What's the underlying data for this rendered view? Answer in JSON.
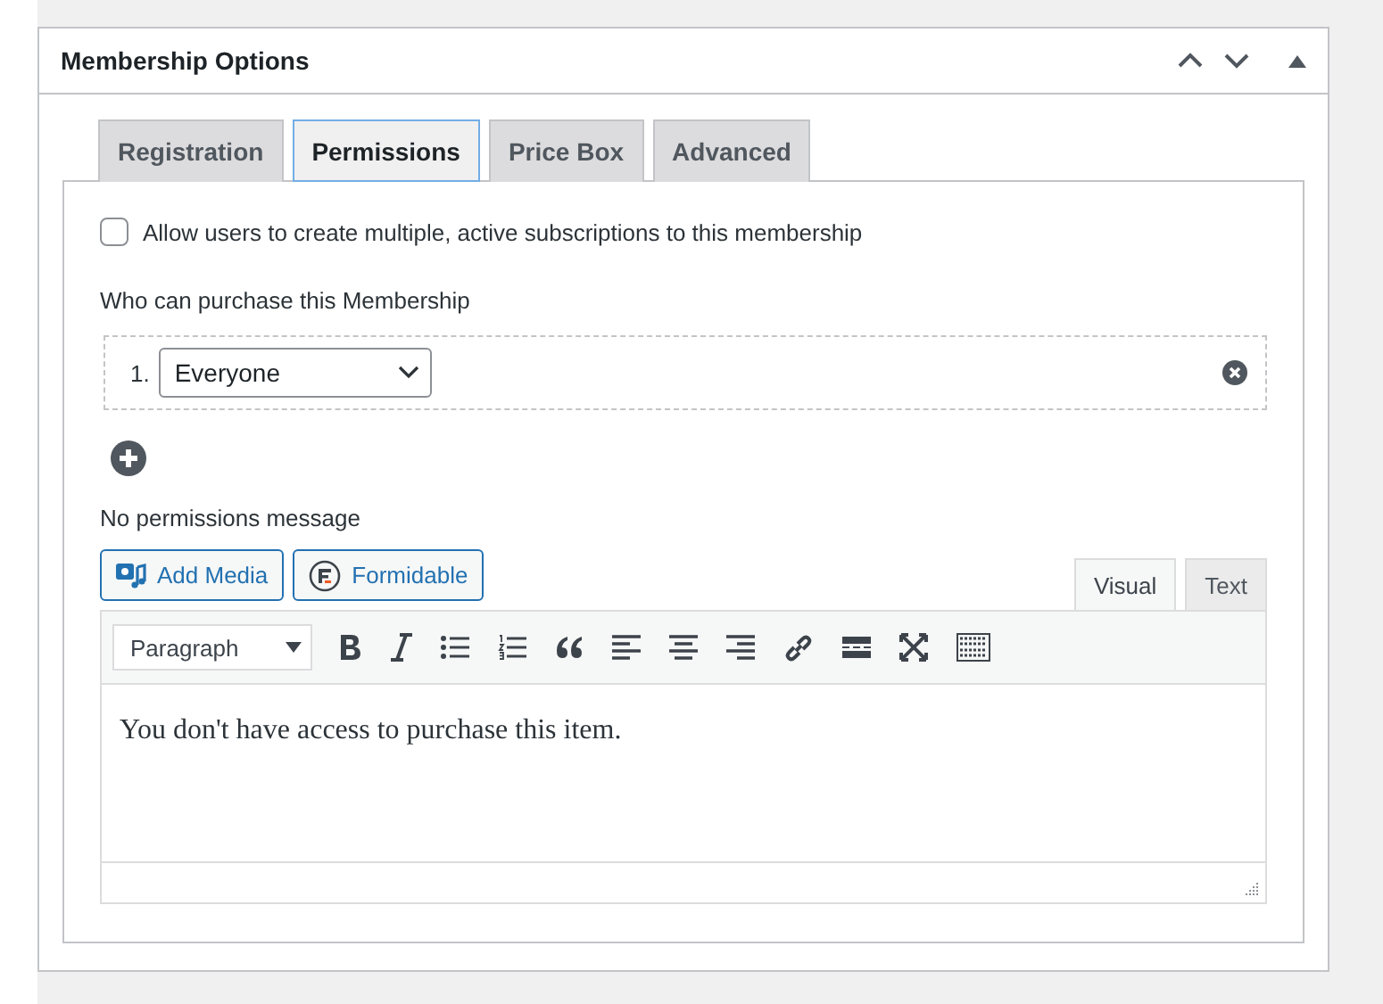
{
  "panel": {
    "title": "Membership Options"
  },
  "tabs": [
    {
      "label": "Registration",
      "selected": false
    },
    {
      "label": "Permissions",
      "selected": true
    },
    {
      "label": "Price Box",
      "selected": false
    },
    {
      "label": "Advanced",
      "selected": false
    }
  ],
  "multiple_subscriptions": {
    "label": "Allow users to create multiple, active subscriptions to this membership",
    "checked": false
  },
  "purchase": {
    "label": "Who can purchase this Membership",
    "rules": [
      {
        "number": "1.",
        "value": "Everyone"
      }
    ]
  },
  "message": {
    "label": "No permissions message",
    "media_buttons": [
      {
        "label": "Add Media",
        "kind": "media"
      },
      {
        "label": "Formidable",
        "kind": "formidable"
      }
    ],
    "editor_tabs": [
      {
        "label": "Visual",
        "selected": true
      },
      {
        "label": "Text",
        "selected": false
      }
    ],
    "format": "Paragraph",
    "toolbar": [
      {
        "kind": "bold"
      },
      {
        "kind": "italic"
      },
      {
        "kind": "bullet-list"
      },
      {
        "kind": "numbered-list"
      },
      {
        "kind": "quote"
      },
      {
        "kind": "align-left"
      },
      {
        "kind": "align-center"
      },
      {
        "kind": "align-right"
      },
      {
        "kind": "link"
      },
      {
        "kind": "read-more"
      },
      {
        "kind": "fullscreen"
      },
      {
        "kind": "toolbar-toggle"
      }
    ],
    "content": "You don't have access to purchase this item."
  }
}
